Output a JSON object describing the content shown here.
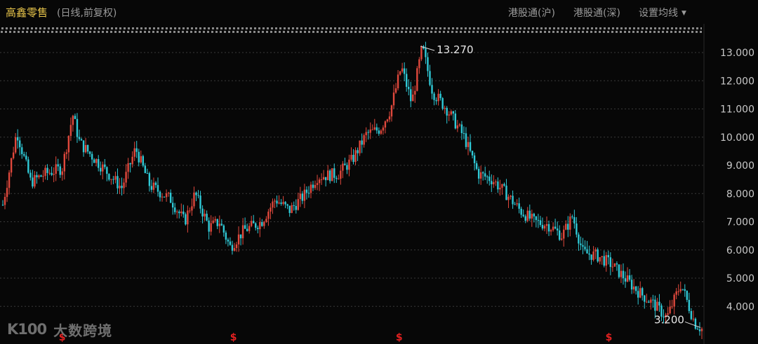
{
  "header": {
    "title": "高鑫零售",
    "subtitle": "(日线,前复权)",
    "buttons": {
      "hk_connect_sh": "港股通(沪)",
      "hk_connect_sz": "港股通(深)",
      "ma_settings": "设置均线"
    }
  },
  "watermark": {
    "logo": "K100",
    "text": "大数跨境"
  },
  "colors": {
    "up": "#e0483c",
    "down": "#2fc9d6",
    "grid": "#3a3a3a",
    "background": "#070707",
    "axis_text": "#c8c8c8",
    "marker": "#e02020"
  },
  "chart_data": {
    "type": "line",
    "style": "candlestick",
    "yticks": [
      "4.000",
      "5.000",
      "6.000",
      "7.000",
      "8.000",
      "9.000",
      "10.000",
      "11.000",
      "12.000",
      "13.000"
    ],
    "ylim": [
      3.2,
      13.3
    ],
    "grid": true,
    "annotations": [
      {
        "text": "13.270",
        "x": 0.5955,
        "y": 13.27,
        "type": "max"
      },
      {
        "text": "3.200",
        "x": 1.0,
        "y": 3.2,
        "type": "min"
      }
    ],
    "event_markers": {
      "label": "$",
      "x": [
        0.085,
        0.33,
        0.567,
        0.867
      ]
    },
    "x": [
      0,
      0.02,
      0.04,
      0.06,
      0.085,
      0.1,
      0.11,
      0.14,
      0.17,
      0.19,
      0.21,
      0.24,
      0.26,
      0.275,
      0.295,
      0.31,
      0.325,
      0.345,
      0.37,
      0.39,
      0.41,
      0.43,
      0.45,
      0.48,
      0.5,
      0.52,
      0.54,
      0.555,
      0.57,
      0.585,
      0.6,
      0.615,
      0.635,
      0.66,
      0.68,
      0.7,
      0.72,
      0.74,
      0.76,
      0.78,
      0.8,
      0.815,
      0.83,
      0.85,
      0.87,
      0.89,
      0.91,
      0.93,
      0.95,
      0.97,
      0.99,
      1.0
    ],
    "values": [
      7.6,
      10.2,
      8.4,
      8.7,
      8.9,
      10.8,
      9.8,
      9.0,
      8.2,
      9.6,
      8.3,
      7.8,
      7.0,
      8.0,
      6.8,
      7.0,
      6.1,
      6.7,
      7.0,
      7.8,
      7.4,
      7.9,
      8.6,
      8.7,
      9.2,
      10.1,
      10.3,
      11.0,
      12.5,
      11.2,
      13.2,
      11.6,
      11.0,
      10.0,
      8.7,
      8.5,
      8.0,
      7.4,
      7.0,
      6.9,
      6.5,
      7.2,
      5.9,
      5.8,
      5.5,
      5.0,
      4.5,
      4.1,
      3.6,
      4.8,
      3.4,
      3.2
    ]
  }
}
